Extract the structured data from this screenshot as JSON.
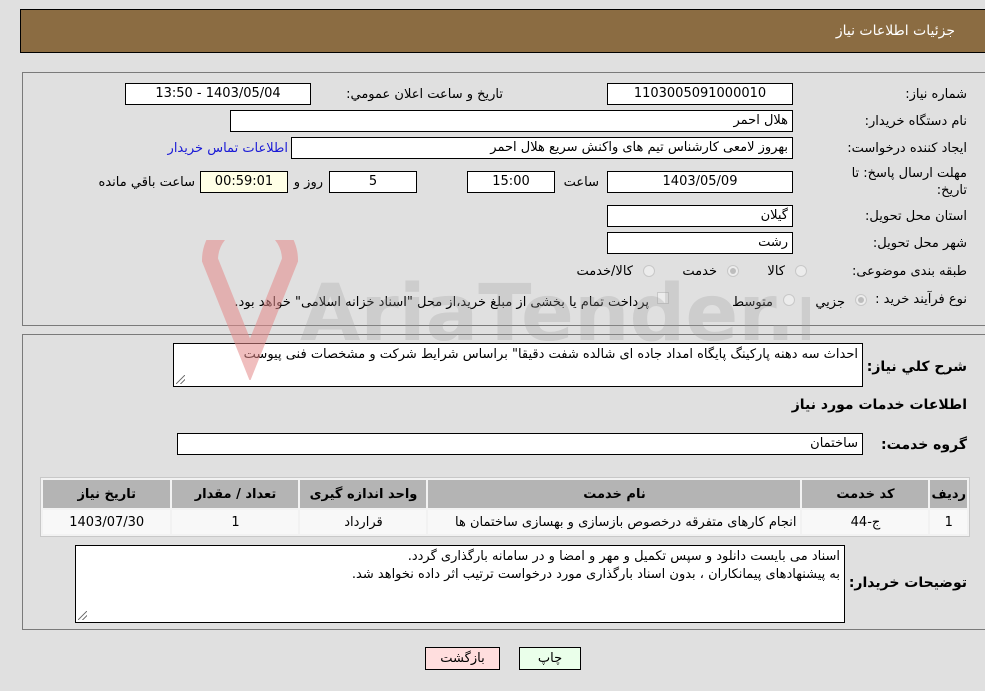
{
  "header": {
    "title": "جزئیات اطلاعات نیاز"
  },
  "form": {
    "need_number": {
      "label": "شماره نیاز:",
      "value": "1103005091000010"
    },
    "announce_datetime": {
      "label": "تاریخ و ساعت اعلان عمومي:",
      "value": "1403/05/04 - 13:50"
    },
    "buyer_org": {
      "label": "نام دستگاه خریدار:",
      "value": "هلال احمر"
    },
    "requester": {
      "label": "ایجاد کننده درخواست:",
      "value": "بهروز  لامعی کارشناس تیم های واکنش سریع هلال احمر"
    },
    "buyer_contact_link": "اطلاعات تماس خریدار",
    "deadline": {
      "label_line1": "مهلت ارسال پاسخ: تا",
      "label_line2": "تاریخ:",
      "date": "1403/05/09",
      "time_label": "ساعت",
      "time": "15:00",
      "days": "5",
      "days_label": "روز و",
      "remaining": "00:59:01",
      "remaining_label": "ساعت باقي مانده"
    },
    "province": {
      "label": "استان محل تحویل:",
      "value": "گیلان"
    },
    "city": {
      "label": "شهر محل تحویل:",
      "value": "رشت"
    },
    "category": {
      "label": "طبقه بندی موضوعی:",
      "options": [
        {
          "label": "کالا",
          "checked": false
        },
        {
          "label": "خدمت",
          "checked": true
        },
        {
          "label": "کالا/خدمت",
          "checked": false
        }
      ]
    },
    "purchase_type": {
      "label": "نوع فرآیند خرید :",
      "options": [
        {
          "label": "جزيي",
          "checked": true
        },
        {
          "label": "متوسط",
          "checked": false
        }
      ],
      "treasury_note": "پرداخت تمام یا بخشی از مبلغ خرید،از محل \"اسناد خزانه اسلامی\" خواهد بود."
    }
  },
  "details": {
    "description_label": "شرح کلي نیاز:",
    "description": "احداث سه دهنه پارکینگ پایگاه امداد جاده ای شالده شفت دقیقا\"  براساس شرایط شرکت و مشخصات فنی پیوست",
    "services_heading": "اطلاعات خدمات مورد نیاز",
    "service_group_label": "گروه خدمت:",
    "service_group": "ساختمان",
    "table": {
      "headers": [
        "ردیف",
        "کد خدمت",
        "نام خدمت",
        "واحد اندازه گیری",
        "تعداد / مقدار",
        "تاریخ نیاز"
      ],
      "rows": [
        [
          "1",
          "ج-44",
          "انجام کارهای متفرقه درخصوص بازسازی و بهسازی ساختمان ها",
          "قرارداد",
          "1",
          "1403/07/30"
        ]
      ]
    },
    "buyer_notes_label": "توضیحات خریدار:",
    "buyer_notes_line1": "اسناد می بایست دانلود و سپس  تکمیل و مهر و امضا و در سامانه بارگذاری گردد.",
    "buyer_notes_line2": "به پیشنهادهای پیمانکاران ، بدون اسناد بارگذاری مورد درخواست ترتیب اثر داده نخواهد شد."
  },
  "buttons": {
    "print": "چاپ",
    "back": "بازگشت"
  },
  "watermark": {
    "text": "AriaTender.neT"
  },
  "colors": {
    "header_bg": "#8b6c42",
    "print_bg": "#eaffea",
    "back_bg": "#ffdede",
    "link": "#1a1ad6"
  }
}
